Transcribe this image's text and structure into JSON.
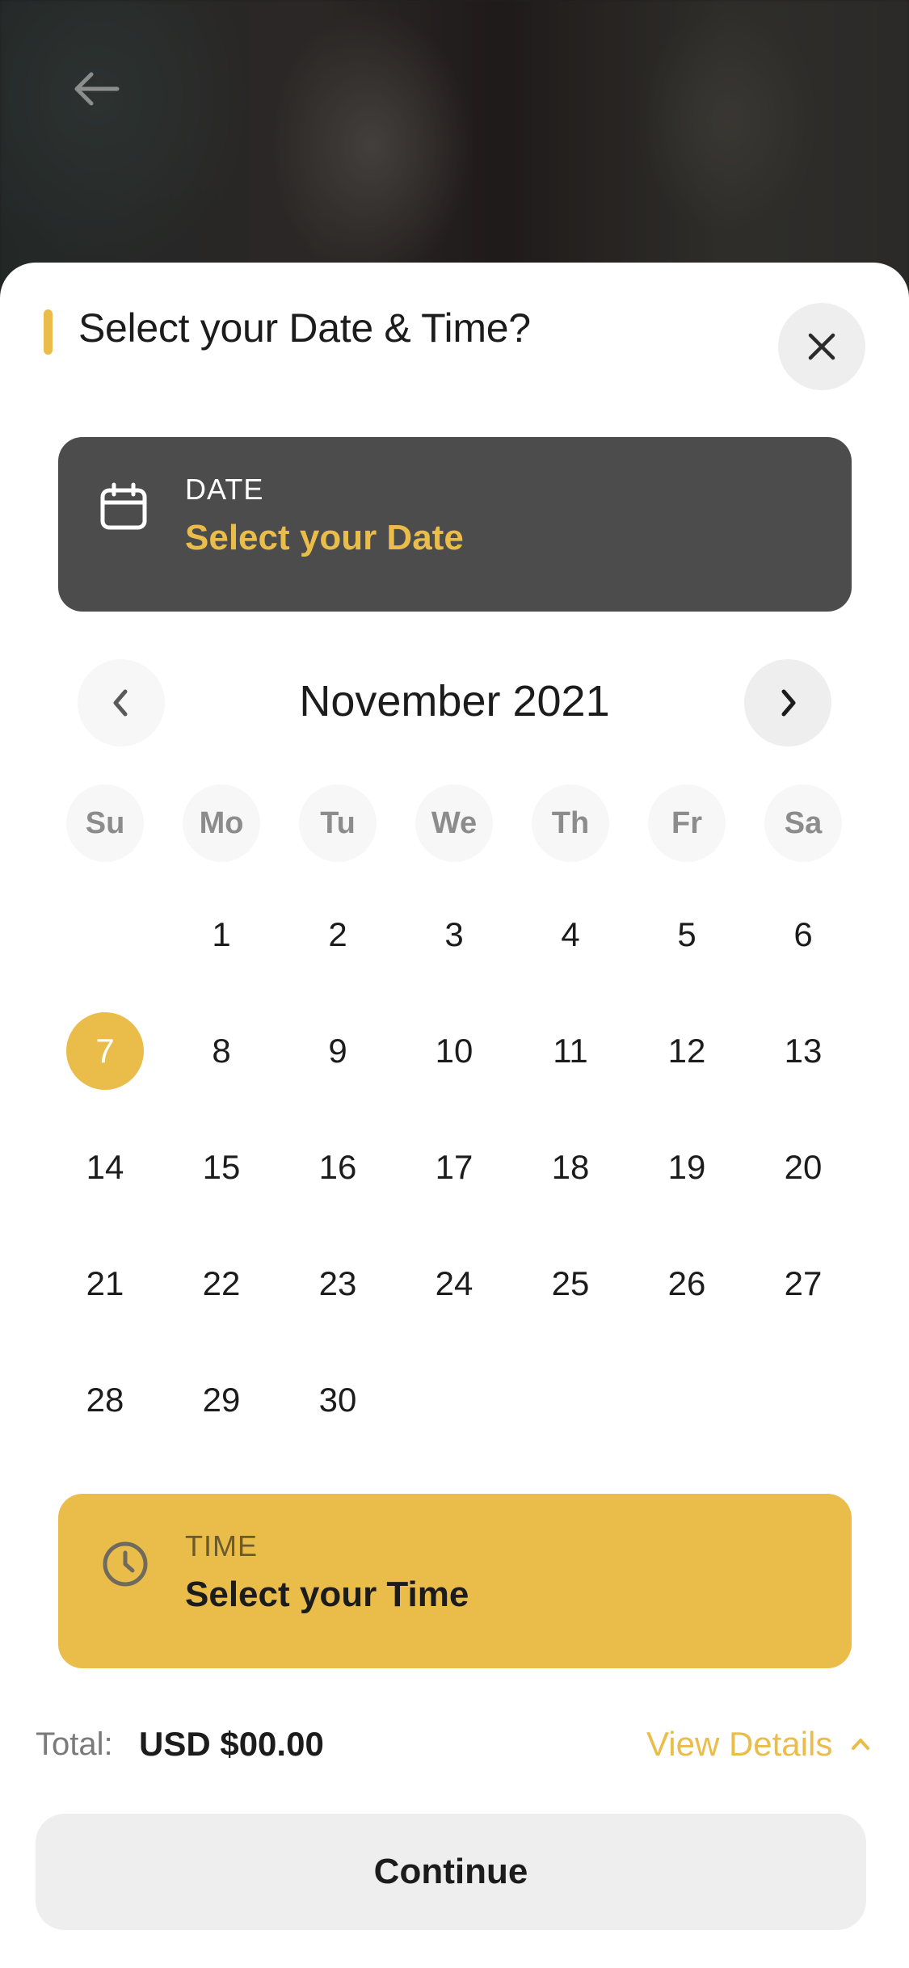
{
  "header": {
    "title": "Select your Date & Time?",
    "accent_color": "#eabd4b",
    "back_icon": "arrow-left-icon",
    "close_icon": "close-icon"
  },
  "date_card": {
    "label": "DATE",
    "value": "Select your Date",
    "icon": "calendar-icon"
  },
  "calendar": {
    "month_title": "November 2021",
    "prev_icon": "chevron-left-icon",
    "next_icon": "chevron-right-icon",
    "weekdays": [
      "Su",
      "Mo",
      "Tu",
      "We",
      "Th",
      "Fr",
      "Sa"
    ],
    "selected_day": "7",
    "weeks": [
      [
        "",
        "1",
        "2",
        "3",
        "4",
        "5",
        "6"
      ],
      [
        "7",
        "8",
        "9",
        "10",
        "11",
        "12",
        "13"
      ],
      [
        "14",
        "15",
        "16",
        "17",
        "18",
        "19",
        "20"
      ],
      [
        "21",
        "22",
        "23",
        "24",
        "25",
        "26",
        "27"
      ],
      [
        "28",
        "29",
        "30",
        "",
        "",
        "",
        ""
      ]
    ]
  },
  "time_card": {
    "label": "TIME",
    "value": "Select your Time",
    "icon": "clock-icon"
  },
  "footer": {
    "total_label": "Total:",
    "total_value": "USD $00.00",
    "view_details": "View Details",
    "view_details_icon": "chevron-up-icon",
    "continue_label": "Continue"
  }
}
